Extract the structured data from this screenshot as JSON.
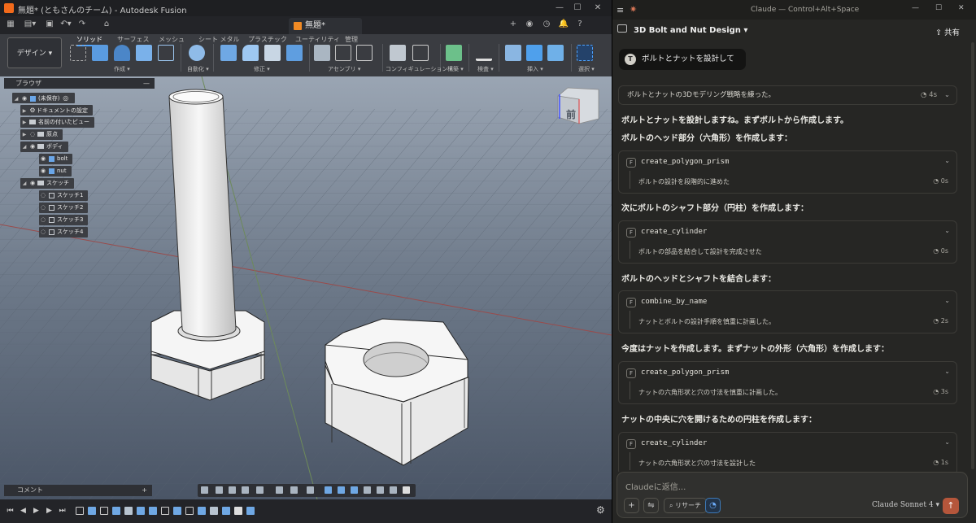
{
  "fusion": {
    "title": "無題* (ともさんのチーム) - Autodesk Fusion",
    "doc_tab": "無題*",
    "workspace": "デザイン",
    "ribbon_tabs": [
      "ソリッド",
      "サーフェス",
      "メッシュ",
      "シート メタル",
      "プラスチック",
      "ユーティリティ",
      "管理"
    ],
    "ribbon_groups": [
      "作成",
      "自動化",
      "修正",
      "アセンブリ",
      "コンフィギュレーション",
      "構築",
      "検査",
      "挿入",
      "選択"
    ],
    "viewcube_label": "前",
    "browser": {
      "title": "ブラウザ",
      "root": "(未保存)",
      "items": [
        "ドキュメントの設定",
        "名前の付いたビュー",
        "原点",
        "ボディ",
        "bolt",
        "nut",
        "スケッチ",
        "スケッチ1",
        "スケッチ2",
        "スケッチ3",
        "スケッチ4"
      ]
    },
    "comment_label": "コメント",
    "accent": "#4da3ff"
  },
  "claude": {
    "window_title": "Claude — Control+Alt+Space",
    "conversation_title": "3D Bolt and Nut Design",
    "share_label": "共有",
    "user_message": "ボルトとナットを設計して",
    "user_initial": "T",
    "thinking": {
      "text": "ボルトとナットの3Dモデリング戦略を練った。",
      "time": "4s"
    },
    "texts": [
      "ボルトとナットを設計しますね。まずボルトから作成します。",
      "ボルトのヘッド部分（六角形）を作成します：",
      "次にボルトのシャフト部分（円柱）を作成します：",
      "ボルトのヘッドとシャフトを結合します：",
      "今度はナットを作成します。まずナットの外形（六角形）を作成します：",
      "ナットの中央に穴を開けるための円柱を作成します："
    ],
    "tools": [
      {
        "name": "create_polygon_prism",
        "summary": "ボルトの設計を段階的に進めた",
        "time": "0s"
      },
      {
        "name": "create_cylinder",
        "summary": "ボルトの部品を結合して設計を完成させた",
        "time": "0s"
      },
      {
        "name": "combine_by_name",
        "summary": "ナットとボルトの設計手順を慎重に計画した。",
        "time": "2s"
      },
      {
        "name": "create_polygon_prism",
        "summary": "ナットの六角形状と穴の寸法を慎重に計画した。",
        "time": "3s"
      },
      {
        "name": "create_cylinder",
        "summary": "ナットの六角形状と穴の寸法を設計した",
        "time": "1s"
      }
    ],
    "input_placeholder": "Claudeに返信...",
    "research_label": "リサーチ",
    "model_label": "Claude Sonnet 4",
    "accent": "#b5563b"
  }
}
